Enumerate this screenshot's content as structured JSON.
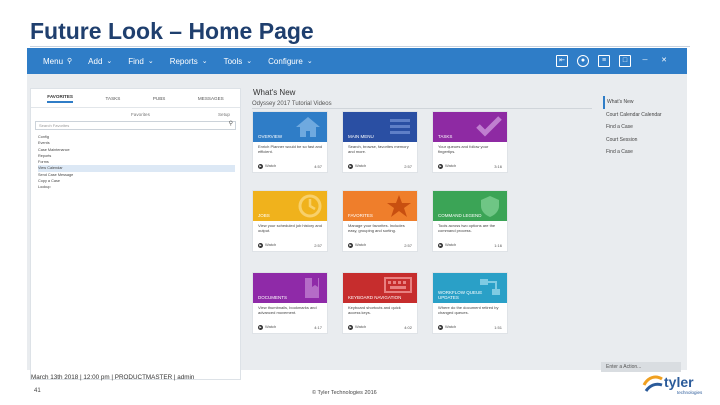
{
  "slide": {
    "title": "Future Look – Home Page",
    "number": "41",
    "copyright": "© Tyler Technologies 2016"
  },
  "menu": [
    {
      "label": "Menu",
      "icon": "search-icon"
    },
    {
      "label": "Add",
      "icon": "chevron-down-icon"
    },
    {
      "label": "Find",
      "icon": "chevron-down-icon"
    },
    {
      "label": "Reports",
      "icon": "chevron-down-icon"
    },
    {
      "label": "Tools",
      "icon": "chevron-down-icon"
    },
    {
      "label": "Configure",
      "icon": "chevron-down-icon"
    }
  ],
  "toolbar_icons": [
    "logout-icon",
    "view-icon",
    "list-icon",
    "restore-icon",
    "minimize-icon",
    "close-icon"
  ],
  "left_panel": {
    "tabs": [
      "FAVORITES",
      "TASKS",
      "PUBS",
      "MESSAGES"
    ],
    "favorites_label": "Favorites",
    "favorites_action": "Setup",
    "search_placeholder": "Search Favorites",
    "items": [
      "Config",
      "Events",
      "Case Maintenance",
      "Reports",
      "Forms",
      "View Calendar",
      "Send Case Message",
      "Copy a Case",
      "Lookup"
    ],
    "selected_index": 5
  },
  "main": {
    "title": "What's New",
    "subtitle": "Odyssey 2017 Tutorial Videos",
    "cards": [
      {
        "label": "OVERVIEW",
        "color": "#2f7dc7",
        "icon": "home-icon",
        "desc": "Enrich Planner would be so fast and efficient.",
        "time": "4:57"
      },
      {
        "label": "MAIN MENU",
        "color": "#2a4fa3",
        "icon": "menu-icon",
        "desc": "Search, browse, favorites memory and more.",
        "time": "2:57"
      },
      {
        "label": "TASKS",
        "color": "#8e2aa3",
        "icon": "check-icon",
        "desc": "Your queues and follow your fingertips.",
        "time": "3:16"
      },
      {
        "label": "JOBS",
        "color": "#f0b21c",
        "icon": "clock-icon",
        "desc": "View your scheduled job history and output.",
        "time": "2:57"
      },
      {
        "label": "FAVORITES",
        "color": "#ef7e2b",
        "icon": "star-icon",
        "desc": "Manage your favorites. Includes easy, grouping and sorting.",
        "time": "2:57"
      },
      {
        "label": "COMMAND LEGEND",
        "color": "#3ba456",
        "icon": "shield-icon",
        "desc": "Tools across two options are the command process.",
        "time": "1:16"
      },
      {
        "label": "DOCUMENTS",
        "color": "#8f2aa8",
        "icon": "document-icon",
        "desc": "View thumbnails, bookmarks and advanced movement.",
        "time": "4:17"
      },
      {
        "label": "KEYBOARD NAVIGATION",
        "color": "#c62d2d",
        "icon": "keyboard-icon",
        "desc": "Keyboard shortcuts and quick access keys.",
        "time": "4:02"
      },
      {
        "label": "WORKFLOW QUEUE UPDATES",
        "color": "#2aa0c7",
        "icon": "workflow-icon",
        "desc": "Where do the document retired by changed queues.",
        "time": "1:51"
      }
    ],
    "watch_label": "Watch"
  },
  "right_nav": {
    "items": [
      "What's New",
      "Court Calendar Calendar",
      "Find a Case",
      "Court Session",
      "Find a Case"
    ],
    "active_index": 0
  },
  "action_box": "Enter a Action...",
  "status": "March 13th 2018 | 12:00 pm | PRODUCTMASTER | admin",
  "logo": {
    "text": "tyler",
    "sub": "technologies"
  }
}
